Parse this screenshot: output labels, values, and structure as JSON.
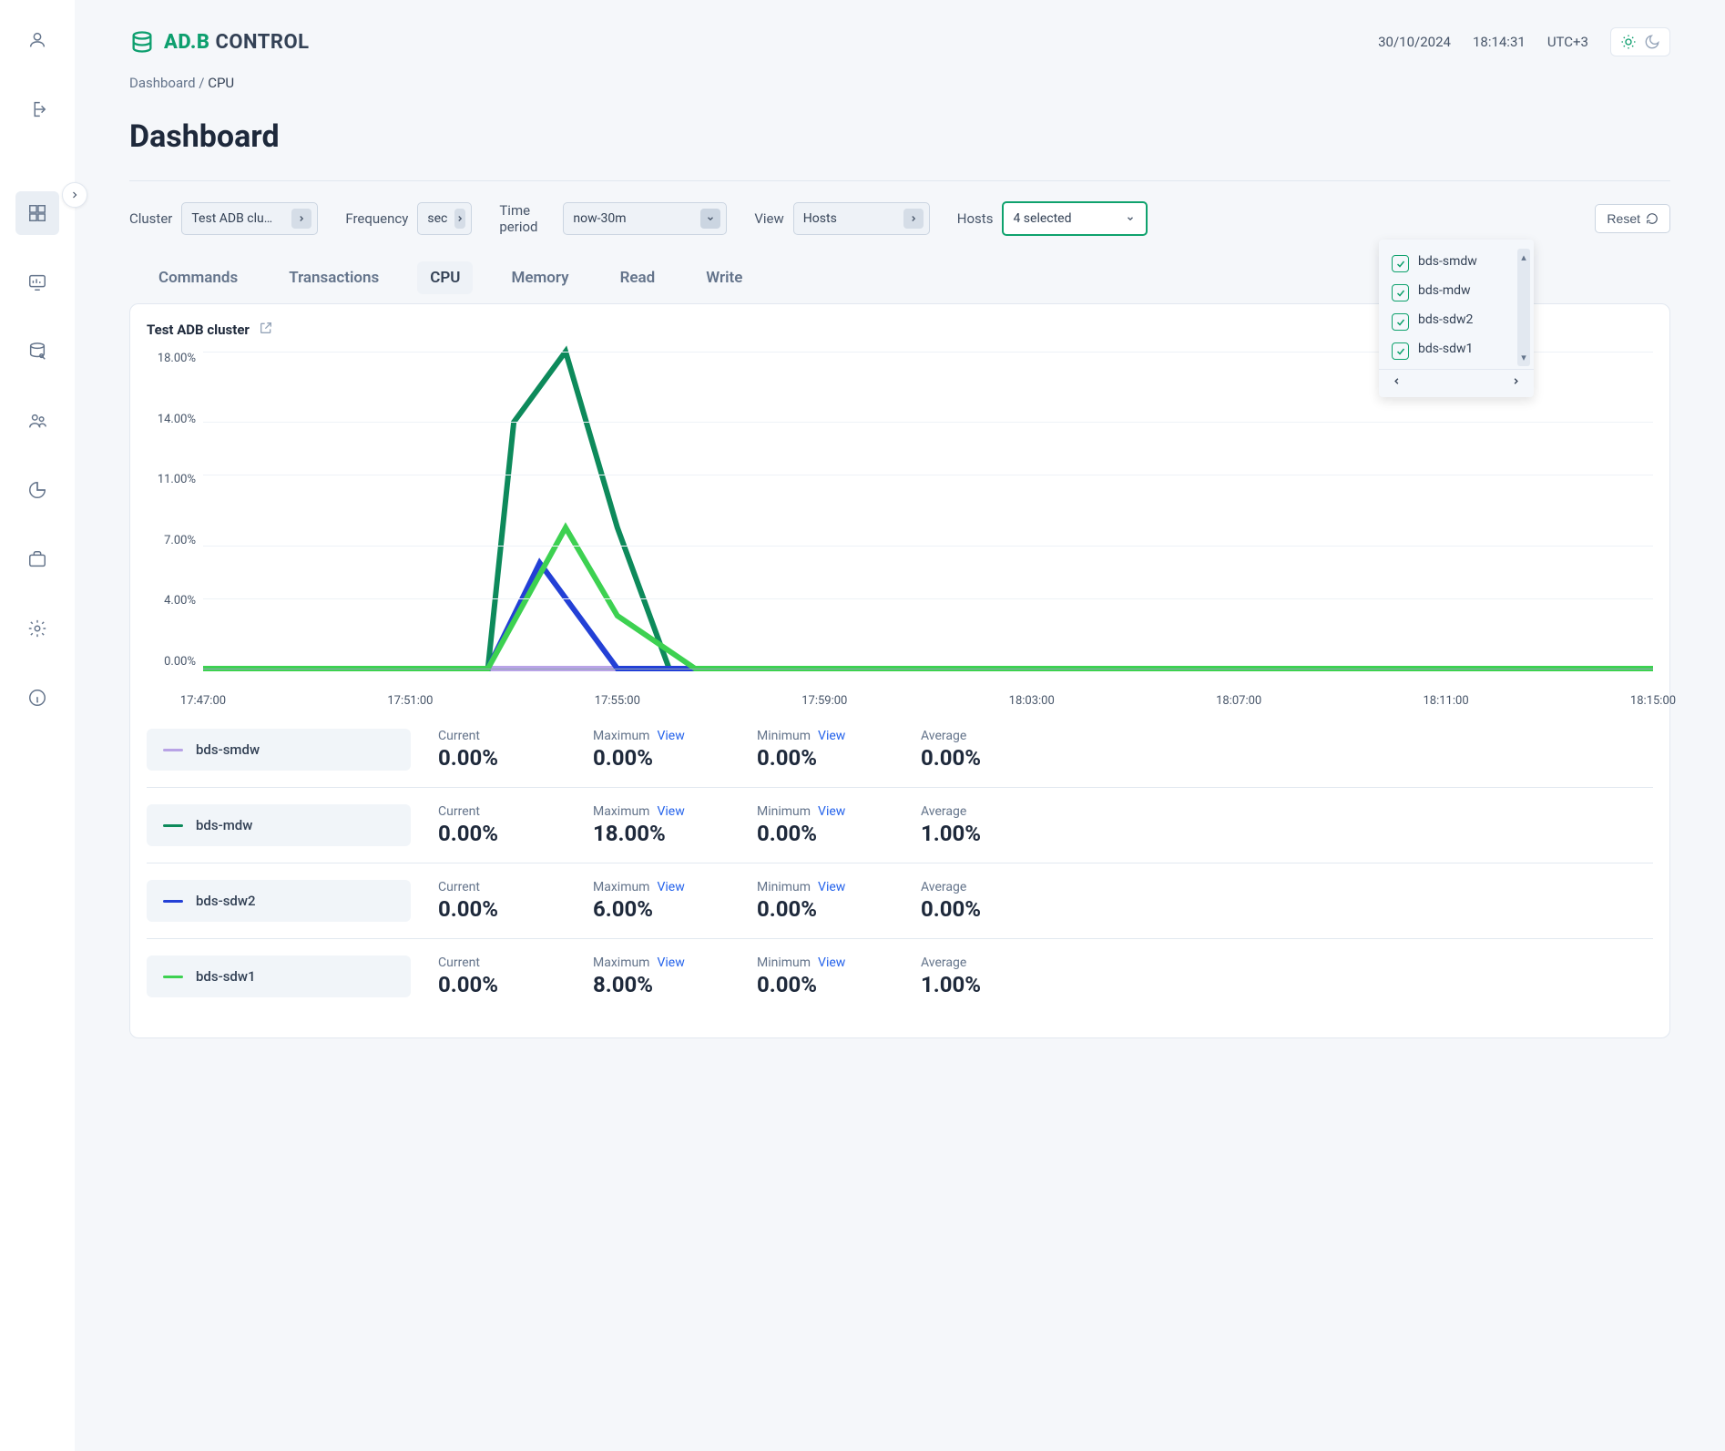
{
  "brand": {
    "prefix": "AD.B",
    "suffix": " CONTROL"
  },
  "topbar": {
    "date": "30/10/2024",
    "time": "18:14:31",
    "tz": "UTC+3"
  },
  "breadcrumb": {
    "parent": "Dashboard",
    "sep": " / ",
    "current": "CPU"
  },
  "page_title": "Dashboard",
  "filters": {
    "cluster_label": "Cluster",
    "cluster_value": "Test ADB clu…",
    "freq_label": "Frequency",
    "freq_value": "sec",
    "period_label": "Time period",
    "period_value": "now-30m",
    "view_label": "View",
    "view_value": "Hosts",
    "hosts_label": "Hosts",
    "hosts_value": "4 selected",
    "reset": "Reset"
  },
  "hosts_dropdown": [
    "bds-smdw",
    "bds-mdw",
    "bds-sdw2",
    "bds-sdw1"
  ],
  "tabs": [
    "Commands",
    "Transactions",
    "CPU",
    "Memory",
    "Read",
    "Write"
  ],
  "chart_card": {
    "title": "Test ADB cluster"
  },
  "chart_data": {
    "type": "line",
    "title": "Test ADB cluster",
    "xlabel": "",
    "ylabel": "",
    "ylim": [
      0,
      18
    ],
    "ytick_labels": [
      "18.00%",
      "14.00%",
      "11.00%",
      "7.00%",
      "4.00%",
      "0.00%"
    ],
    "yticks": [
      18,
      14,
      11,
      7,
      4,
      0
    ],
    "x_categories": [
      "17:47:00",
      "17:51:00",
      "17:55:00",
      "17:59:00",
      "18:03:00",
      "18:07:00",
      "18:11:00",
      "18:15:00"
    ],
    "series": [
      {
        "name": "bds-smdw",
        "color": "#b8a3e6",
        "points": [
          [
            "17:47:00",
            0
          ],
          [
            "17:51:00",
            0
          ],
          [
            "17:52:30",
            0
          ],
          [
            "17:53:30",
            0
          ],
          [
            "17:55:00",
            0
          ],
          [
            "17:56:30",
            0
          ],
          [
            "17:59:00",
            0
          ],
          [
            "18:03:00",
            0
          ],
          [
            "18:07:00",
            0
          ],
          [
            "18:11:00",
            0
          ],
          [
            "18:15:00",
            0
          ]
        ]
      },
      {
        "name": "bds-mdw",
        "color": "#0d8a5b",
        "points": [
          [
            "17:47:00",
            0
          ],
          [
            "17:51:00",
            0
          ],
          [
            "17:52:30",
            0
          ],
          [
            "17:53:00",
            14
          ],
          [
            "17:54:00",
            18
          ],
          [
            "17:55:00",
            8
          ],
          [
            "17:56:00",
            0
          ],
          [
            "17:56:30",
            0
          ],
          [
            "17:59:00",
            0
          ],
          [
            "18:03:00",
            0
          ],
          [
            "18:07:00",
            0
          ],
          [
            "18:11:00",
            0
          ],
          [
            "18:15:00",
            0
          ]
        ]
      },
      {
        "name": "bds-sdw2",
        "color": "#2340d6",
        "points": [
          [
            "17:47:00",
            0
          ],
          [
            "17:51:00",
            0
          ],
          [
            "17:52:30",
            0
          ],
          [
            "17:53:30",
            6
          ],
          [
            "17:55:00",
            0
          ],
          [
            "17:56:30",
            0
          ],
          [
            "17:59:00",
            0
          ],
          [
            "18:03:00",
            0
          ],
          [
            "18:07:00",
            0
          ],
          [
            "18:11:00",
            0
          ],
          [
            "18:15:00",
            0
          ]
        ]
      },
      {
        "name": "bds-sdw1",
        "color": "#3dd151",
        "points": [
          [
            "17:47:00",
            0
          ],
          [
            "17:51:00",
            0
          ],
          [
            "17:52:30",
            0
          ],
          [
            "17:54:00",
            8
          ],
          [
            "17:55:00",
            3
          ],
          [
            "17:56:00",
            1
          ],
          [
            "17:56:30",
            0
          ],
          [
            "17:59:00",
            0
          ],
          [
            "18:03:00",
            0
          ],
          [
            "18:07:00",
            0
          ],
          [
            "18:11:00",
            0
          ],
          [
            "18:15:00",
            0
          ]
        ]
      }
    ]
  },
  "stat_labels": {
    "current": "Current",
    "max": "Maximum",
    "min": "Minimum",
    "avg": "Average",
    "view": "View"
  },
  "legend": [
    {
      "host": "bds-smdw",
      "color": "#b8a3e6",
      "current": "0.00%",
      "max": "0.00%",
      "min": "0.00%",
      "avg": "0.00%"
    },
    {
      "host": "bds-mdw",
      "color": "#0d8a5b",
      "current": "0.00%",
      "max": "18.00%",
      "min": "0.00%",
      "avg": "1.00%"
    },
    {
      "host": "bds-sdw2",
      "color": "#2340d6",
      "current": "0.00%",
      "max": "6.00%",
      "min": "0.00%",
      "avg": "0.00%"
    },
    {
      "host": "bds-sdw1",
      "color": "#3dd151",
      "current": "0.00%",
      "max": "8.00%",
      "min": "0.00%",
      "avg": "1.00%"
    }
  ]
}
